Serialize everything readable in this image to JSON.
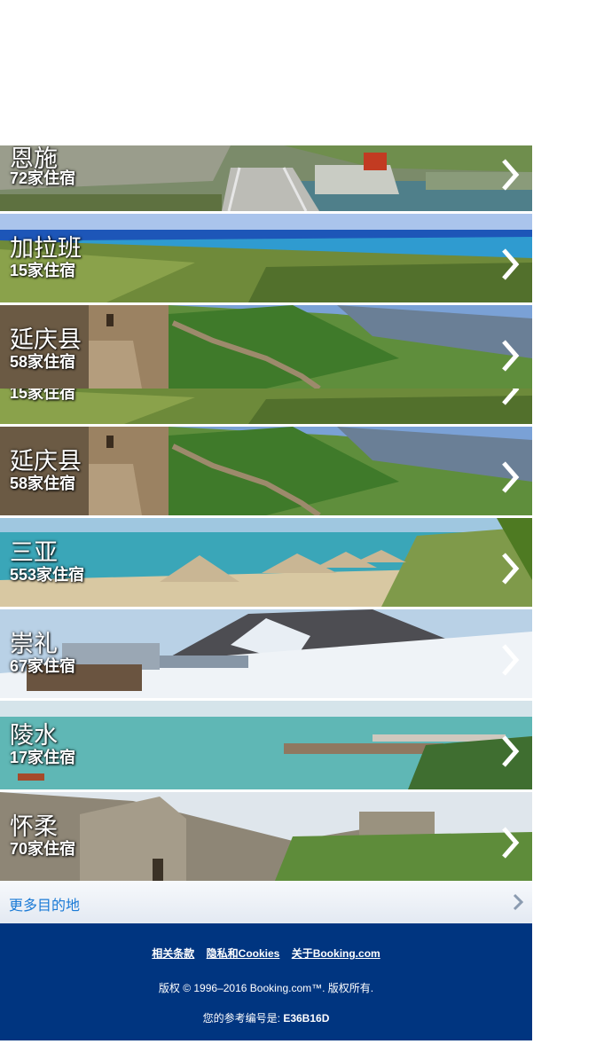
{
  "destinations": [
    {
      "name": "恩施",
      "count": "72家住宿",
      "scene": "dam"
    },
    {
      "name": "加拉班",
      "count": "15家住宿",
      "scene": "coast"
    },
    {
      "name": "延庆县",
      "count": "58家住宿",
      "scene": "wall-hills"
    },
    {
      "name": "",
      "count": "15家住宿",
      "scene": "coast-strip"
    },
    {
      "name": "延庆县",
      "count": "58家住宿",
      "scene": "wall-hills"
    },
    {
      "name": "三亚",
      "count": "553家住宿",
      "scene": "beach"
    },
    {
      "name": "崇礼",
      "count": "67家住宿",
      "scene": "snow"
    },
    {
      "name": "陵水",
      "count": "17家住宿",
      "scene": "sea"
    },
    {
      "name": "怀柔",
      "count": "70家住宿",
      "scene": "great-wall"
    }
  ],
  "more": {
    "label": "更多目的地",
    "icon": "chevron-right-icon"
  },
  "footer": {
    "link_terms": "相关条款",
    "link_privacy": "隐私和Cookies",
    "link_about": "关于Booking.com",
    "copyright": "版权 © 1996–2016 Booking.com™. 版权所有.",
    "ref_label": "您的参考编号是:",
    "ref_code": "E36B16D"
  },
  "colors": {
    "footer_bg": "#003580",
    "link_blue": "#1a7ad6"
  }
}
